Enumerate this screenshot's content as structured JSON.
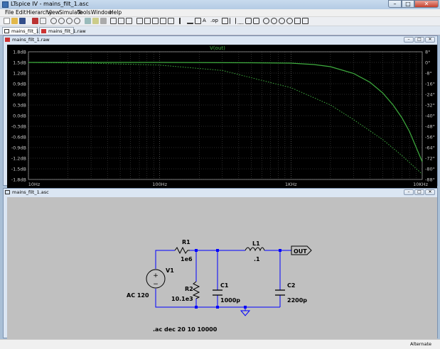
{
  "window": {
    "title": "LTspice IV - mains_filt_1.asc"
  },
  "menu": [
    "File",
    "Edit",
    "Hierarchy",
    "View",
    "Simulate",
    "Tools",
    "Window",
    "Help"
  ],
  "tabs": [
    "mains_filt_1.asc",
    "mains_filt_1.raw"
  ],
  "waveform": {
    "title": "mains_filt_1.raw",
    "trace_label": "V(out)",
    "y_left_ticks": [
      "1.8dB",
      "1.5dB",
      "1.2dB",
      "0.9dB",
      "0.6dB",
      "0.3dB",
      "0.0dB",
      "-0.3dB",
      "-0.6dB",
      "-0.9dB",
      "-1.2dB",
      "-1.5dB",
      "-1.8dB"
    ],
    "y_right_ticks": [
      "8°",
      "0°",
      "-8°",
      "-16°",
      "-24°",
      "-32°",
      "-40°",
      "-48°",
      "-56°",
      "-64°",
      "-72°",
      "-80°",
      "-88°"
    ],
    "x_ticks": [
      "10Hz",
      "100Hz",
      "1KHz",
      "10KHz"
    ],
    "colors": {
      "background": "#000000",
      "grid": "#6a6a6a",
      "trace": "#3fae3f",
      "axis_text": "#c8c8c8"
    }
  },
  "chart_data": {
    "type": "line",
    "title": "",
    "trace_label": "V(out)",
    "x_scale": "log",
    "xlim": [
      10,
      10000
    ],
    "x_ticks": [
      "10Hz",
      "100Hz",
      "1KHz",
      "10KHz"
    ],
    "ylim_left": [
      -1.8,
      1.8
    ],
    "ylim_right": [
      -88,
      8
    ],
    "grid": true,
    "series": [
      {
        "name": "V(out)",
        "axis": "left",
        "style": "solid",
        "x": [
          10,
          100,
          500,
          1000,
          1500,
          2000,
          3000,
          4000,
          5000,
          6000,
          7000,
          8000,
          10000
        ],
        "y": [
          1.5,
          1.5,
          1.49,
          1.48,
          1.44,
          1.38,
          1.19,
          0.94,
          0.64,
          0.3,
          -0.06,
          -0.45,
          -1.3
        ]
      },
      {
        "style": "dotted",
        "axis": "right",
        "x": [
          10,
          30,
          100,
          300,
          1000,
          2000,
          3000,
          5000,
          7000,
          10000
        ],
        "y": [
          0,
          -0.6,
          -2,
          -6,
          -19,
          -32,
          -43,
          -58,
          -70,
          -84
        ]
      }
    ]
  },
  "schematic": {
    "title": "mains_filt_1.asc",
    "components": {
      "v1": {
        "name": "V1",
        "value": "AC 120"
      },
      "r1": {
        "name": "R1",
        "value": "1e6"
      },
      "r2": {
        "name": "R2",
        "value": "10.1e3"
      },
      "c1": {
        "name": "C1",
        "value": "1000p"
      },
      "l1": {
        "name": "L1",
        "value": ".1"
      },
      "c2": {
        "name": "C2",
        "value": "2200p"
      }
    },
    "out_label": "OUT",
    "directive": ".ac dec 20 10 10000",
    "colors": {
      "background": "#c0c0c0",
      "wire": "#0000ff",
      "component": "#000000"
    }
  },
  "status": {
    "mode": "Alternate"
  }
}
